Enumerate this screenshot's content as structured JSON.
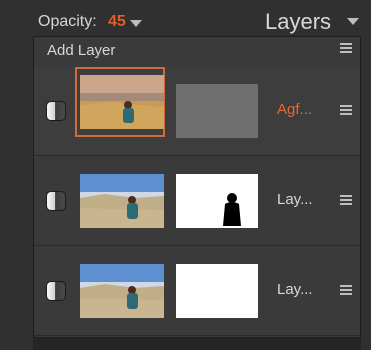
{
  "toolbar": {
    "opacity_label": "Opacity:",
    "opacity_value": "45",
    "panel_title": "Layers"
  },
  "add_layer": {
    "label": "Add Layer"
  },
  "layers": [
    {
      "name": "Agf...",
      "selected": true,
      "mask": "gray"
    },
    {
      "name": "Lay...",
      "selected": false,
      "mask": "silhouette"
    },
    {
      "name": "Lay...",
      "selected": false,
      "mask": "white"
    }
  ],
  "colors": {
    "accent": "#e25b2b",
    "background": "#303030",
    "list_bg": "#3a3a3a"
  },
  "icons": {
    "visibility": "eye-toggle-icon",
    "menu": "hamburger-menu-icon",
    "dropdown": "caret-down-icon"
  }
}
